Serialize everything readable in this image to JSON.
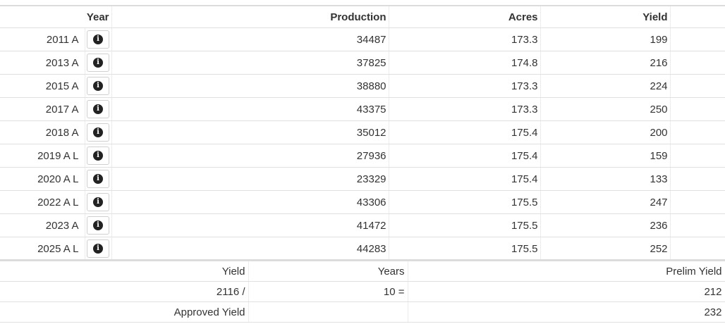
{
  "table": {
    "headers": {
      "year": "Year",
      "production": "Production",
      "acres": "Acres",
      "yield": "Yield"
    },
    "rows": [
      {
        "year": "2011 A",
        "production": "34487",
        "acres": "173.3",
        "yield": "199"
      },
      {
        "year": "2013 A",
        "production": "37825",
        "acres": "174.8",
        "yield": "216"
      },
      {
        "year": "2015 A",
        "production": "38880",
        "acres": "173.3",
        "yield": "224"
      },
      {
        "year": "2017 A",
        "production": "43375",
        "acres": "173.3",
        "yield": "250"
      },
      {
        "year": "2018 A",
        "production": "35012",
        "acres": "175.4",
        "yield": "200"
      },
      {
        "year": "2019 A L",
        "production": "27936",
        "acres": "175.4",
        "yield": "159"
      },
      {
        "year": "2020 A L",
        "production": "23329",
        "acres": "175.4",
        "yield": "133"
      },
      {
        "year": "2022 A L",
        "production": "43306",
        "acres": "175.5",
        "yield": "247"
      },
      {
        "year": "2023 A",
        "production": "41472",
        "acres": "175.5",
        "yield": "236"
      },
      {
        "year": "2025 A L",
        "production": "44283",
        "acres": "175.5",
        "yield": "252"
      }
    ],
    "info_icon": "info-circle-icon"
  },
  "summary": {
    "yield_label": "Yield",
    "years_label": "Years",
    "prelim_label": "Prelim Yield",
    "yield_total": "2116 /",
    "years_count": "10 =",
    "prelim_value": "212",
    "approved_label": "Approved Yield",
    "approved_value": "232"
  }
}
